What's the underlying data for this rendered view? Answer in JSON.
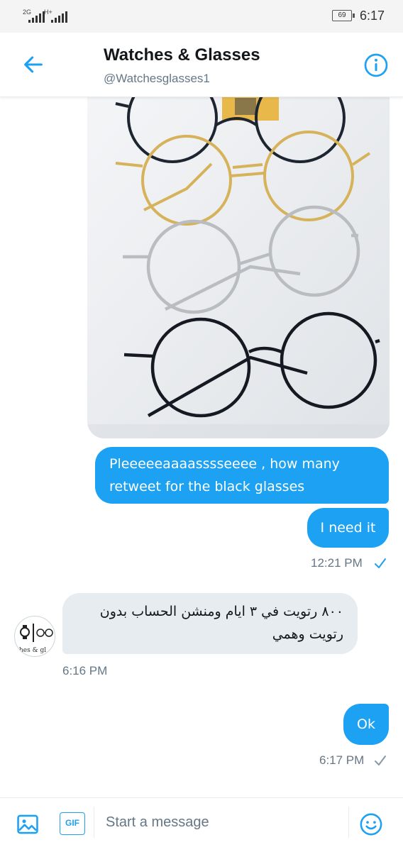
{
  "status_bar": {
    "network1": "2G",
    "network2": "H+",
    "battery": "69",
    "time": "6:17"
  },
  "header": {
    "title": "Watches & Glasses",
    "handle": "@Watchesglasses1"
  },
  "messages": [
    {
      "text": "Pleeeeeaaaasssseeee , how many retweet for the black glasses"
    },
    {
      "text": "I need it"
    },
    {
      "text": "٨٠٠ رتويت في ٣ ايام ومنشن الحساب بدون رتويت وهمي"
    },
    {
      "text": "Ok"
    }
  ],
  "timestamps": {
    "first": "12:21 PM",
    "second": "6:16 PM",
    "third": "6:17 PM"
  },
  "avatar_text": "hes & gl",
  "composer": {
    "placeholder": "Start a message",
    "gif_label": "GIF"
  },
  "colors": {
    "accent": "#1da1f2",
    "incoming_bubble": "#e6ecf0",
    "text": "#14171a",
    "secondary": "#657786"
  }
}
